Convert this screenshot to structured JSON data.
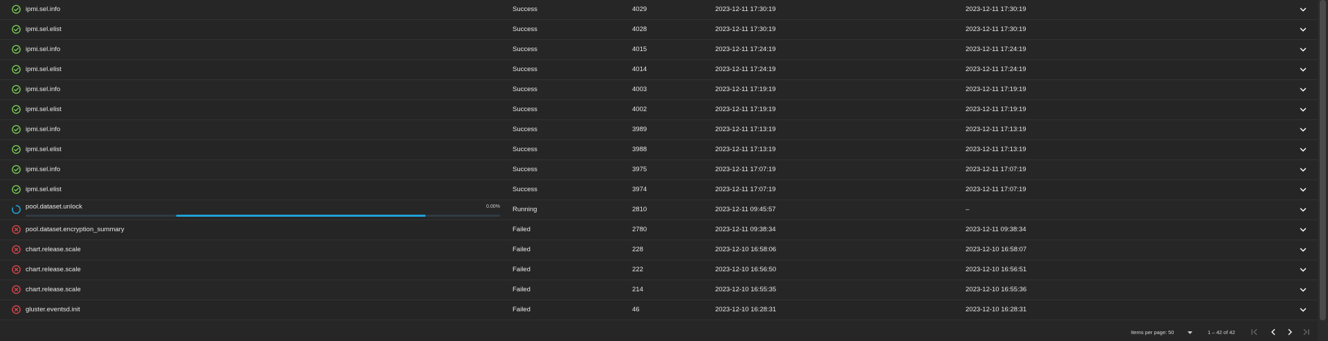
{
  "colors": {
    "success": "#7ed957",
    "failed": "#e5484d",
    "running": "#1fa2d8"
  },
  "jobs": [
    {
      "method": "ipmi.sel.info",
      "state": "Success",
      "id": "4029",
      "started": "2023-12-11 17:30:19",
      "finished": "2023-12-11 17:30:19",
      "icon": "check-circle-icon"
    },
    {
      "method": "ipmi.sel.elist",
      "state": "Success",
      "id": "4028",
      "started": "2023-12-11 17:30:19",
      "finished": "2023-12-11 17:30:19",
      "icon": "check-circle-icon"
    },
    {
      "method": "ipmi.sel.info",
      "state": "Success",
      "id": "4015",
      "started": "2023-12-11 17:24:19",
      "finished": "2023-12-11 17:24:19",
      "icon": "check-circle-icon"
    },
    {
      "method": "ipmi.sel.elist",
      "state": "Success",
      "id": "4014",
      "started": "2023-12-11 17:24:19",
      "finished": "2023-12-11 17:24:19",
      "icon": "check-circle-icon"
    },
    {
      "method": "ipmi.sel.info",
      "state": "Success",
      "id": "4003",
      "started": "2023-12-11 17:19:19",
      "finished": "2023-12-11 17:19:19",
      "icon": "check-circle-icon"
    },
    {
      "method": "ipmi.sel.elist",
      "state": "Success",
      "id": "4002",
      "started": "2023-12-11 17:19:19",
      "finished": "2023-12-11 17:19:19",
      "icon": "check-circle-icon"
    },
    {
      "method": "ipmi.sel.info",
      "state": "Success",
      "id": "3989",
      "started": "2023-12-11 17:13:19",
      "finished": "2023-12-11 17:13:19",
      "icon": "check-circle-icon"
    },
    {
      "method": "ipmi.sel.elist",
      "state": "Success",
      "id": "3988",
      "started": "2023-12-11 17:13:19",
      "finished": "2023-12-11 17:13:19",
      "icon": "check-circle-icon"
    },
    {
      "method": "ipmi.sel.info",
      "state": "Success",
      "id": "3975",
      "started": "2023-12-11 17:07:19",
      "finished": "2023-12-11 17:07:19",
      "icon": "check-circle-icon"
    },
    {
      "method": "ipmi.sel.elist",
      "state": "Success",
      "id": "3974",
      "started": "2023-12-11 17:07:19",
      "finished": "2023-12-11 17:07:19",
      "icon": "check-circle-icon"
    },
    {
      "method": "pool.dataset.unlock",
      "state": "Running",
      "id": "2810",
      "started": "2023-12-11 09:45:57",
      "finished": "–",
      "icon": "spinner-icon",
      "progress_label": "0.00%",
      "progress": 0
    },
    {
      "method": "pool.dataset.encryption_summary",
      "state": "Failed",
      "id": "2780",
      "started": "2023-12-11 09:38:34",
      "finished": "2023-12-11 09:38:34",
      "icon": "error-circle-icon"
    },
    {
      "method": "chart.release.scale",
      "state": "Failed",
      "id": "228",
      "started": "2023-12-10 16:58:06",
      "finished": "2023-12-10 16:58:07",
      "icon": "error-circle-icon"
    },
    {
      "method": "chart.release.scale",
      "state": "Failed",
      "id": "222",
      "started": "2023-12-10 16:56:50",
      "finished": "2023-12-10 16:56:51",
      "icon": "error-circle-icon"
    },
    {
      "method": "chart.release.scale",
      "state": "Failed",
      "id": "214",
      "started": "2023-12-10 16:55:35",
      "finished": "2023-12-10 16:55:36",
      "icon": "error-circle-icon"
    },
    {
      "method": "gluster.eventsd.init",
      "state": "Failed",
      "id": "46",
      "started": "2023-12-10 16:28:31",
      "finished": "2023-12-10 16:28:31",
      "icon": "error-circle-icon"
    }
  ],
  "paginator": {
    "items_per_page_label": "Items per page:",
    "items_per_page_value": "50",
    "range_label": "1 – 42 of 42"
  }
}
